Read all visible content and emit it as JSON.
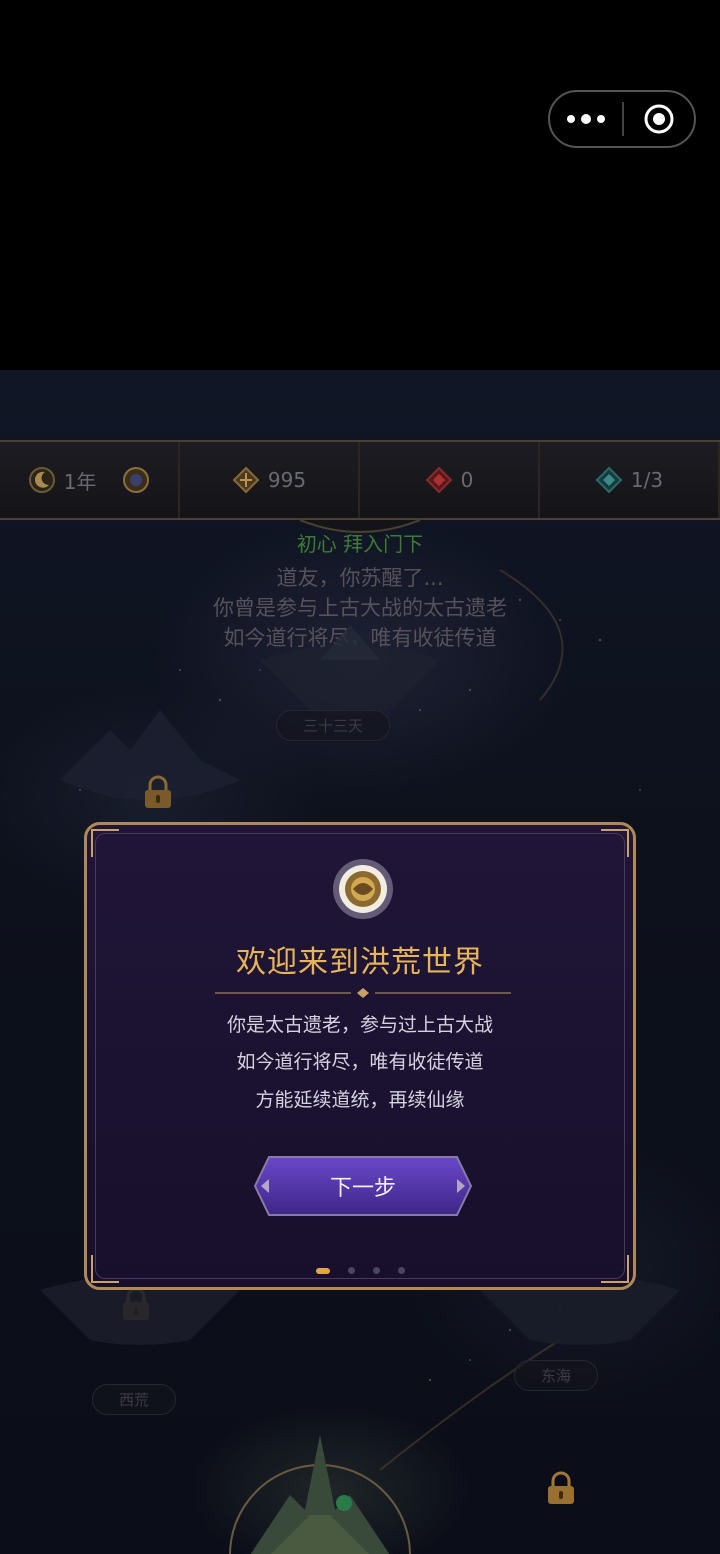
{
  "stats": [
    {
      "icon": "moon-icon",
      "value": "1年",
      "extra_icon": "sun-emblem-icon"
    },
    {
      "icon": "rune-gold-icon",
      "value": "995"
    },
    {
      "icon": "red-gem-icon",
      "value": "0"
    },
    {
      "icon": "cyan-crystal-icon",
      "value": "1/3"
    }
  ],
  "story": {
    "headline": "初心  拜入门下",
    "lines": [
      "道友，你苏醒了...",
      "你曾是参与上古大战的太古遗老",
      "如今道行将尽，唯有收徒传道"
    ]
  },
  "regions": {
    "heaven": "三十三天",
    "west": "西荒",
    "east": "东海"
  },
  "modal": {
    "title": "欢迎来到洪荒世界",
    "lines": [
      "你是太古遗老，参与过上古大战",
      "如今道行将尽，唯有收徒传道",
      "方能延续道统，再续仙缘"
    ],
    "next_label": "下一步",
    "page_index": 1,
    "page_count": 4
  },
  "colors": {
    "accent_gold": "#e8b45a",
    "modal_bg": "#1d1334",
    "button_purple": "#5a3ab0",
    "story_green": "#3d7a35"
  }
}
